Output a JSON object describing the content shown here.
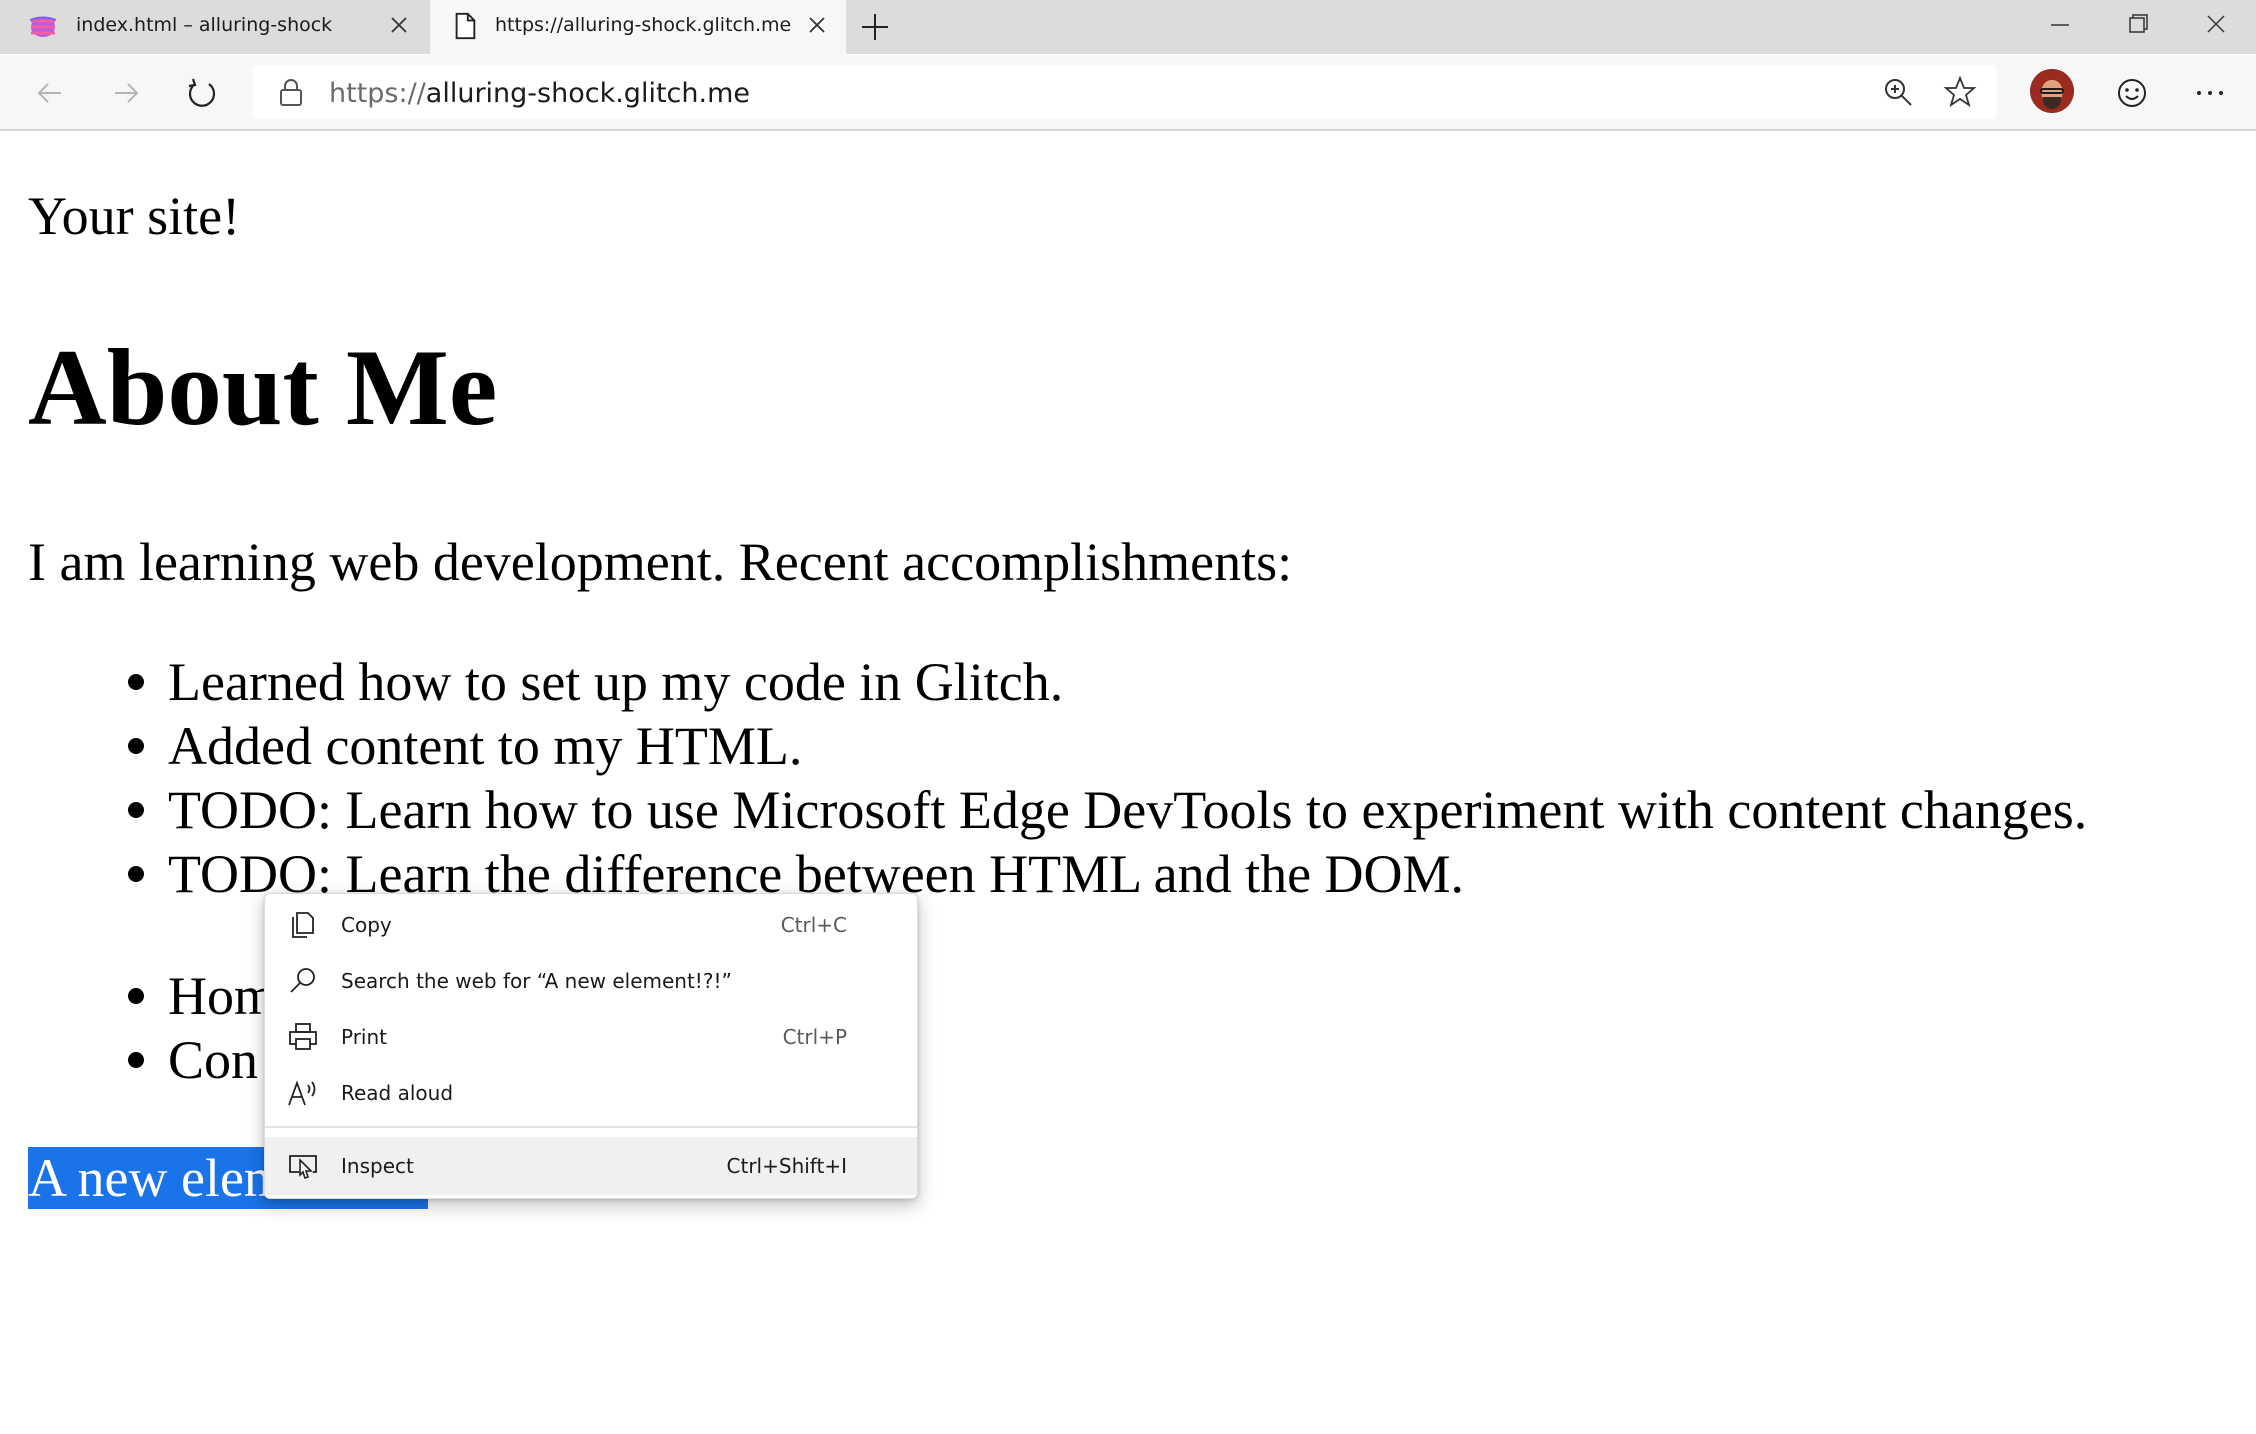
{
  "tabs": [
    {
      "title": "index.html – alluring-shock",
      "favicon": "glitch-fish-icon",
      "active": false
    },
    {
      "title": "https://alluring-shock.glitch.me",
      "favicon": "page-icon",
      "active": true
    }
  ],
  "address": {
    "scheme": "https://",
    "host": "alluring-shock.glitch.me"
  },
  "content": {
    "site_title": "Your site!",
    "heading": "About Me",
    "intro": "I am learning web development. Recent accomplishments:",
    "accomplishments": [
      "Learned how to set up my code in Glitch.",
      "Added content to my HTML.",
      "TODO: Learn how to use Microsoft Edge DevTools to experiment with content changes.",
      "TODO: Learn the difference between HTML and the DOM."
    ],
    "links": [
      "Hom",
      "Con"
    ],
    "selected_text": "A new element!?!"
  },
  "context_menu": {
    "items": [
      {
        "label": "Copy",
        "shortcut": "Ctrl+C",
        "icon": "copy-icon"
      },
      {
        "label": "Search the web for “A new element!?!”",
        "shortcut": "",
        "icon": "search-icon"
      },
      {
        "label": "Print",
        "shortcut": "Ctrl+P",
        "icon": "print-icon"
      },
      {
        "label": "Read aloud",
        "shortcut": "",
        "icon": "read-aloud-icon"
      },
      {
        "label": "Inspect",
        "shortcut": "Ctrl+Shift+I",
        "icon": "inspect-icon",
        "highlighted": true
      }
    ]
  },
  "colors": {
    "selection": "#1a73e8",
    "tabstrip": "#dcdcdc",
    "toolbar": "#f7f7f7"
  }
}
